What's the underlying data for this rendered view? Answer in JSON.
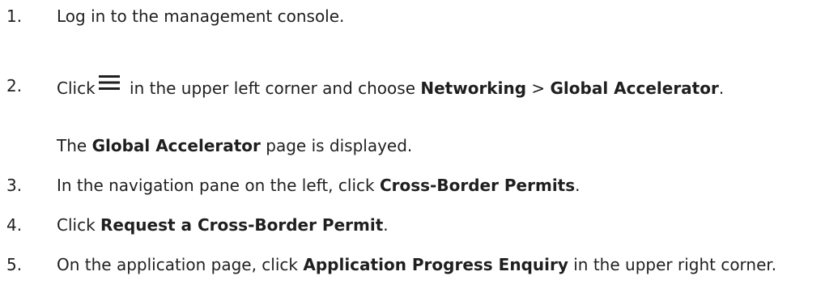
{
  "steps": [
    {
      "number": "1.",
      "text": "Log in to the management console."
    },
    {
      "number": "2.",
      "prefix": "Click",
      "icon": "menu-icon",
      "middle": " in the upper left corner and choose ",
      "bold1": "Networking",
      "sep": " > ",
      "bold2": "Global Accelerator",
      "suffix": ".",
      "result_bold": "Global Accelerator",
      "result_rest": " page is displayed.",
      "result_prefix": "The "
    },
    {
      "number": "3.",
      "prefix": "In the navigation pane on the left, click ",
      "bold": "Cross-Border Permits",
      "suffix": "."
    },
    {
      "number": "4.",
      "prefix": "Click ",
      "bold": "Request a Cross-Border Permit",
      "suffix": "."
    },
    {
      "number": "5.",
      "prefix": "On the application page, click ",
      "bold": "Application Progress Enquiry",
      "suffix": " in the upper right corner."
    }
  ]
}
